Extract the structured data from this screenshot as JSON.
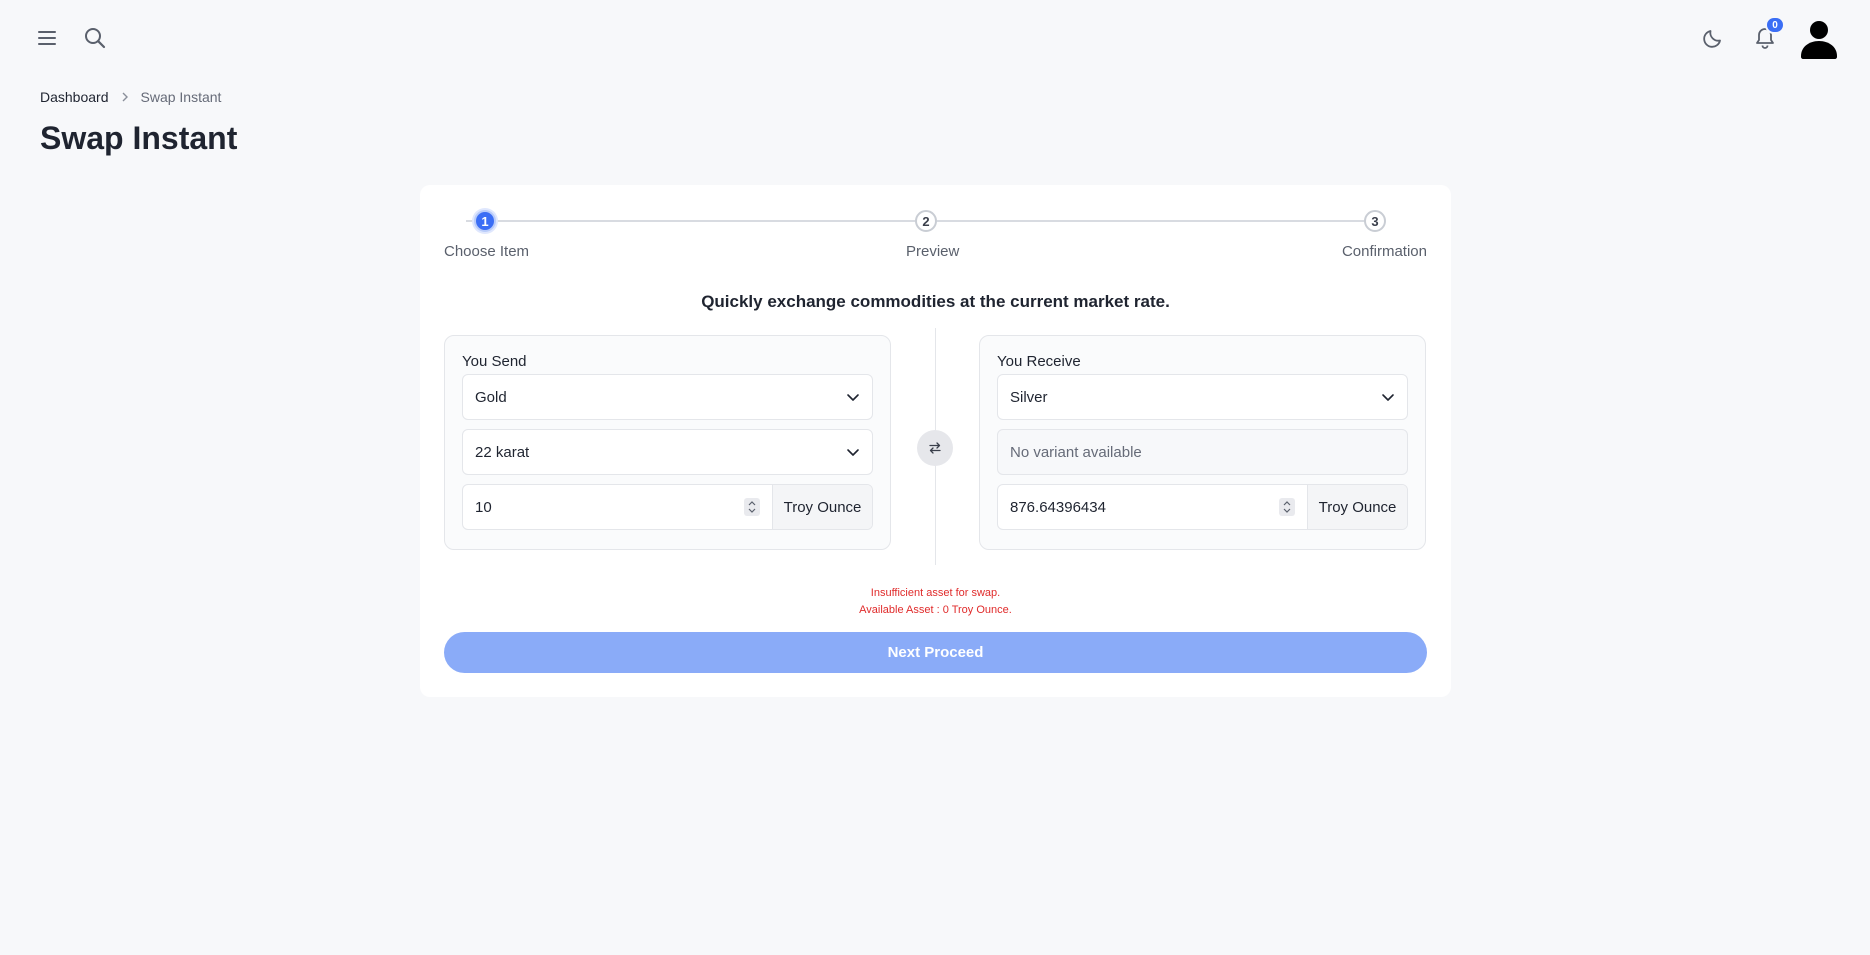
{
  "header": {
    "menu_icon": "hamburger-icon",
    "search_icon": "search-icon",
    "theme_icon": "moon-icon",
    "notifications_icon": "bell-icon",
    "notification_count": "0",
    "avatar_icon": "user-icon"
  },
  "breadcrumb": {
    "home": "Dashboard",
    "current": "Swap Instant"
  },
  "page_title": "Swap Instant",
  "stepper": {
    "steps": [
      {
        "number": "1",
        "label": "Choose Item",
        "active": true
      },
      {
        "number": "2",
        "label": "Preview",
        "active": false
      },
      {
        "number": "3",
        "label": "Confirmation",
        "active": false
      }
    ]
  },
  "subtitle": "Quickly exchange commodities at the current market rate.",
  "send": {
    "label": "You Send",
    "commodity": "Gold",
    "variant": "22 karat",
    "amount": "10",
    "unit": "Troy Ounce"
  },
  "receive": {
    "label": "You Receive",
    "commodity": "Silver",
    "variant": "No variant available",
    "amount": "876.64396434",
    "unit": "Troy Ounce"
  },
  "error": {
    "line1": "Insufficient asset for swap.",
    "line2": "Available Asset : 0 Troy Ounce."
  },
  "proceed_label": "Next Proceed",
  "colors": {
    "accent": "#3b6ef5",
    "button_disabled": "#8aabf8",
    "error": "#e02b2b",
    "background": "#f7f8fa"
  }
}
